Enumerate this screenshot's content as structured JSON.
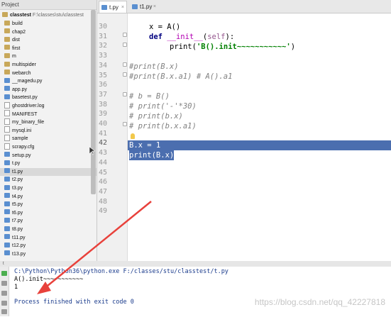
{
  "project_panel": {
    "header": "Project",
    "root_name": "classtest",
    "root_path": "F:\\classes\\stu\\classtest",
    "items": [
      {
        "label": "build",
        "kind": "folder"
      },
      {
        "label": "chap2",
        "kind": "folder"
      },
      {
        "label": "dist",
        "kind": "folder"
      },
      {
        "label": "first",
        "kind": "folder"
      },
      {
        "label": "m",
        "kind": "folder"
      },
      {
        "label": "multispider",
        "kind": "folder"
      },
      {
        "label": "webarch",
        "kind": "folder"
      },
      {
        "label": "__magedu.py",
        "kind": "py"
      },
      {
        "label": "app.py",
        "kind": "py"
      },
      {
        "label": "basetest.py",
        "kind": "py"
      },
      {
        "label": "ghostdriver.log",
        "kind": "file"
      },
      {
        "label": "MANIFEST",
        "kind": "file"
      },
      {
        "label": "my_binary_file",
        "kind": "file"
      },
      {
        "label": "mysql.ini",
        "kind": "file"
      },
      {
        "label": "sample",
        "kind": "file"
      },
      {
        "label": "scrapy.cfg",
        "kind": "file"
      },
      {
        "label": "setup.py",
        "kind": "py"
      },
      {
        "label": "t.py",
        "kind": "py"
      },
      {
        "label": "t1.py",
        "kind": "py",
        "selected": true
      },
      {
        "label": "t2.py",
        "kind": "py"
      },
      {
        "label": "t3.py",
        "kind": "py"
      },
      {
        "label": "t4.py",
        "kind": "py"
      },
      {
        "label": "t5.py",
        "kind": "py"
      },
      {
        "label": "t6.py",
        "kind": "py"
      },
      {
        "label": "t7.py",
        "kind": "py"
      },
      {
        "label": "t8.py",
        "kind": "py"
      },
      {
        "label": "t11.py",
        "kind": "py"
      },
      {
        "label": "t12.py",
        "kind": "py"
      },
      {
        "label": "t13.py",
        "kind": "py"
      }
    ]
  },
  "tabs": [
    {
      "label": "t.py",
      "active": true
    },
    {
      "label": "t1.py",
      "active": false
    }
  ],
  "editor": {
    "line_numbers": [
      "30",
      "31",
      "32",
      "33",
      "34",
      "35",
      "36",
      "37",
      "38",
      "39",
      "40",
      "41",
      "42",
      "43",
      "44",
      "45",
      "46",
      "47",
      "48",
      "49"
    ],
    "current_line": "42",
    "lines": {
      "l30": {
        "var": "x",
        "rest": " = A()"
      },
      "l31": {
        "kw": "def",
        "name": "__init__",
        "p1": "(",
        "self": "self",
        "p2": "):"
      },
      "l32": {
        "fn": "print",
        "p1": "(",
        "str": "'B().init~~~~~~~~~~~'",
        "p2": ")"
      },
      "l34": "#print(B.x)",
      "l35": "#print(B.x.a1) # A().a1",
      "l37": "# b = B()",
      "l38": "# print('-'*30)",
      "l39": "# print(b.x)",
      "l40": "# print(b.x.a1)",
      "l42": "B.x = 1",
      "l43": "print(B.x)"
    }
  },
  "run_panel": {
    "header": "t",
    "command": "C:\\Python\\Python36\\python.exe F:/classes/stu/classtest/t.py",
    "output": [
      "A().init~~~~~~~~~~~",
      "1"
    ],
    "status": "Process finished with exit code 0"
  },
  "watermark": "https://blog.csdn.net/qq_42227818"
}
